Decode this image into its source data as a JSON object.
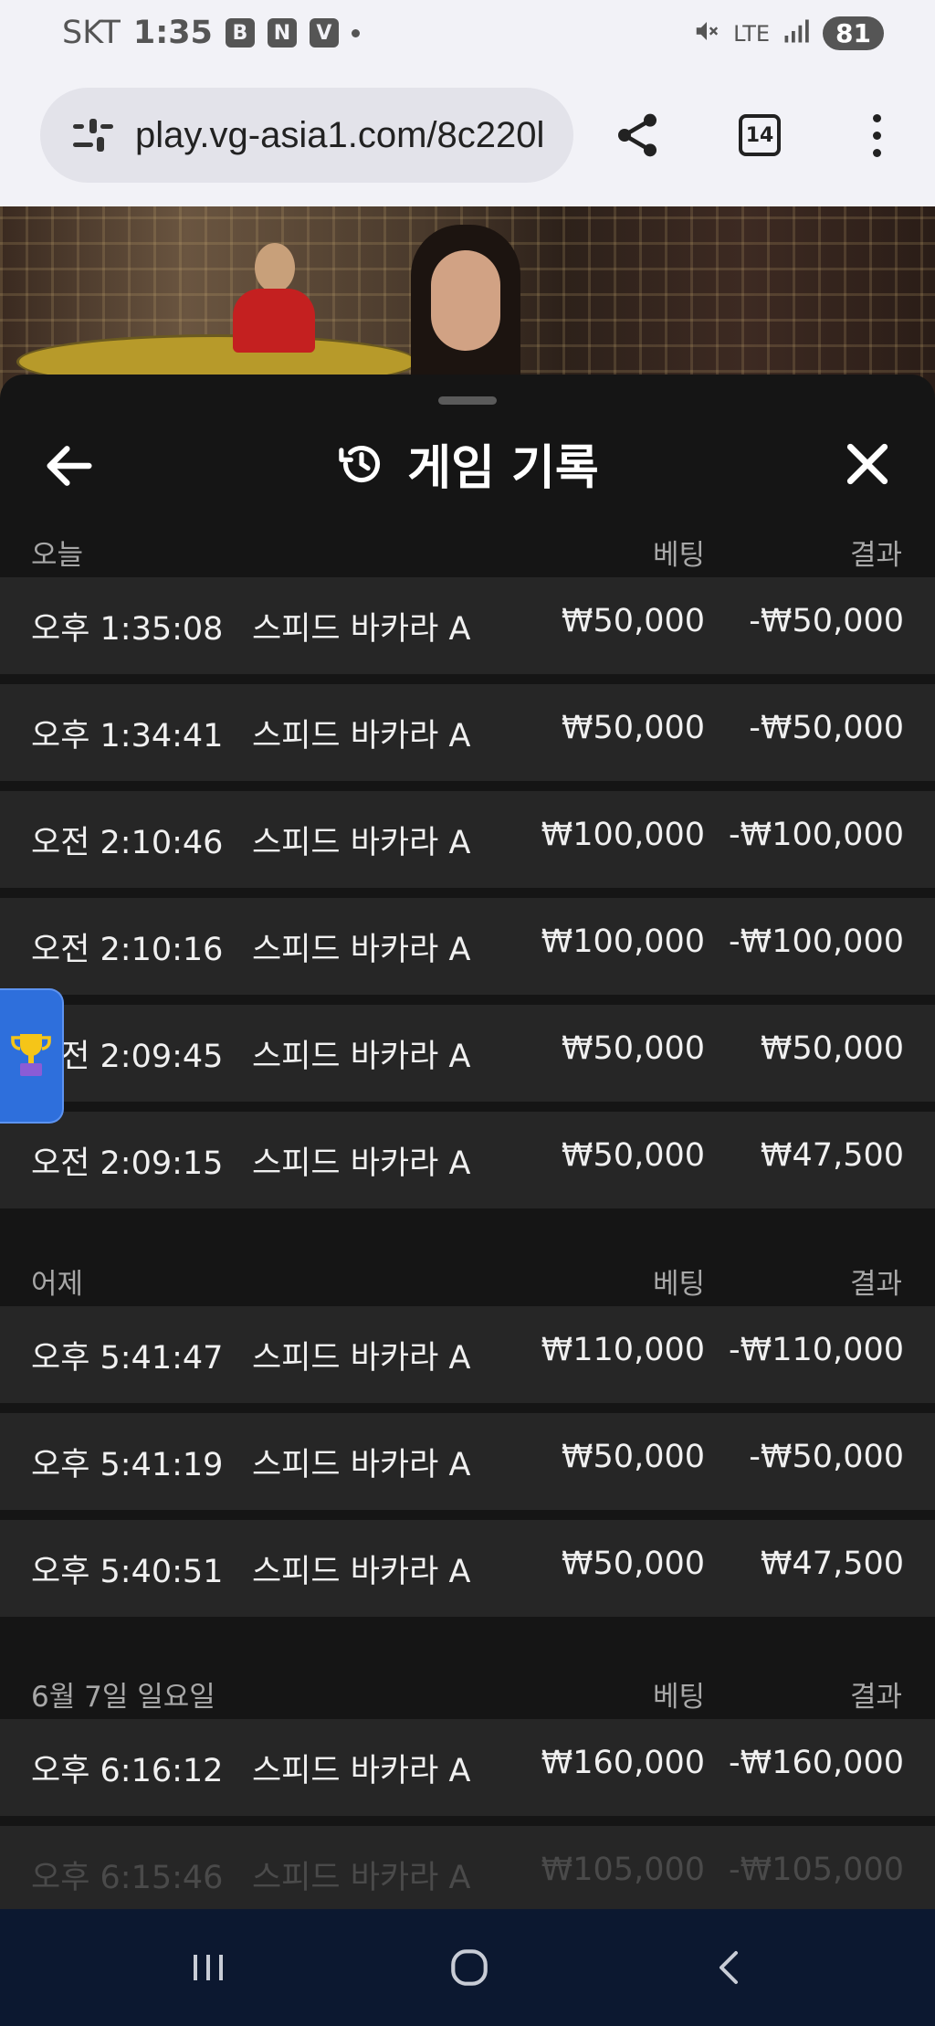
{
  "status_bar": {
    "carrier": "SKT",
    "time": "1:35",
    "notif_icons": [
      "B",
      "N",
      "V"
    ],
    "lte": "LTE",
    "battery": "81"
  },
  "browser": {
    "url": "play.vg-asia1.com/8c220l",
    "tab_count": "14"
  },
  "panel": {
    "title": "게임 기록"
  },
  "sections": [
    {
      "date": "오늘",
      "bet_header": "베팅",
      "result_header": "결과",
      "rows": [
        {
          "time": "오후 1:35:08",
          "game": "스피드 바카라 A",
          "bet": "₩50,000",
          "result": "-₩50,000"
        },
        {
          "time": "오후 1:34:41",
          "game": "스피드 바카라 A",
          "bet": "₩50,000",
          "result": "-₩50,000"
        },
        {
          "time": "오전 2:10:46",
          "game": "스피드 바카라 A",
          "bet": "₩100,000",
          "result": "-₩100,000"
        },
        {
          "time": "오전 2:10:16",
          "game": "스피드 바카라 A",
          "bet": "₩100,000",
          "result": "-₩100,000"
        },
        {
          "time": "오전 2:09:45",
          "game": "스피드 바카라 A",
          "bet": "₩50,000",
          "result": "₩50,000"
        },
        {
          "time": "오전 2:09:15",
          "game": "스피드 바카라 A",
          "bet": "₩50,000",
          "result": "₩47,500"
        }
      ]
    },
    {
      "date": "어제",
      "bet_header": "베팅",
      "result_header": "결과",
      "rows": [
        {
          "time": "오후 5:41:47",
          "game": "스피드 바카라 A",
          "bet": "₩110,000",
          "result": "-₩110,000"
        },
        {
          "time": "오후 5:41:19",
          "game": "스피드 바카라 A",
          "bet": "₩50,000",
          "result": "-₩50,000"
        },
        {
          "time": "오후 5:40:51",
          "game": "스피드 바카라 A",
          "bet": "₩50,000",
          "result": "₩47,500"
        }
      ]
    },
    {
      "date": "6월 7일 일요일",
      "bet_header": "베팅",
      "result_header": "결과",
      "rows": [
        {
          "time": "오후 6:16:12",
          "game": "스피드 바카라 A",
          "bet": "₩160,000",
          "result": "-₩160,000"
        },
        {
          "time": "오후 6:15:46",
          "game": "스피드 바카라 A",
          "bet": "₩105,000",
          "result": "-₩105,000"
        }
      ]
    }
  ],
  "floating": {
    "trophy_icon": "trophy-icon"
  },
  "colors": {
    "panel_bg": "#151515",
    "row_bg": "#262626",
    "accent_blue": "#2e6fdc",
    "nav_bg": "#0c1830"
  }
}
